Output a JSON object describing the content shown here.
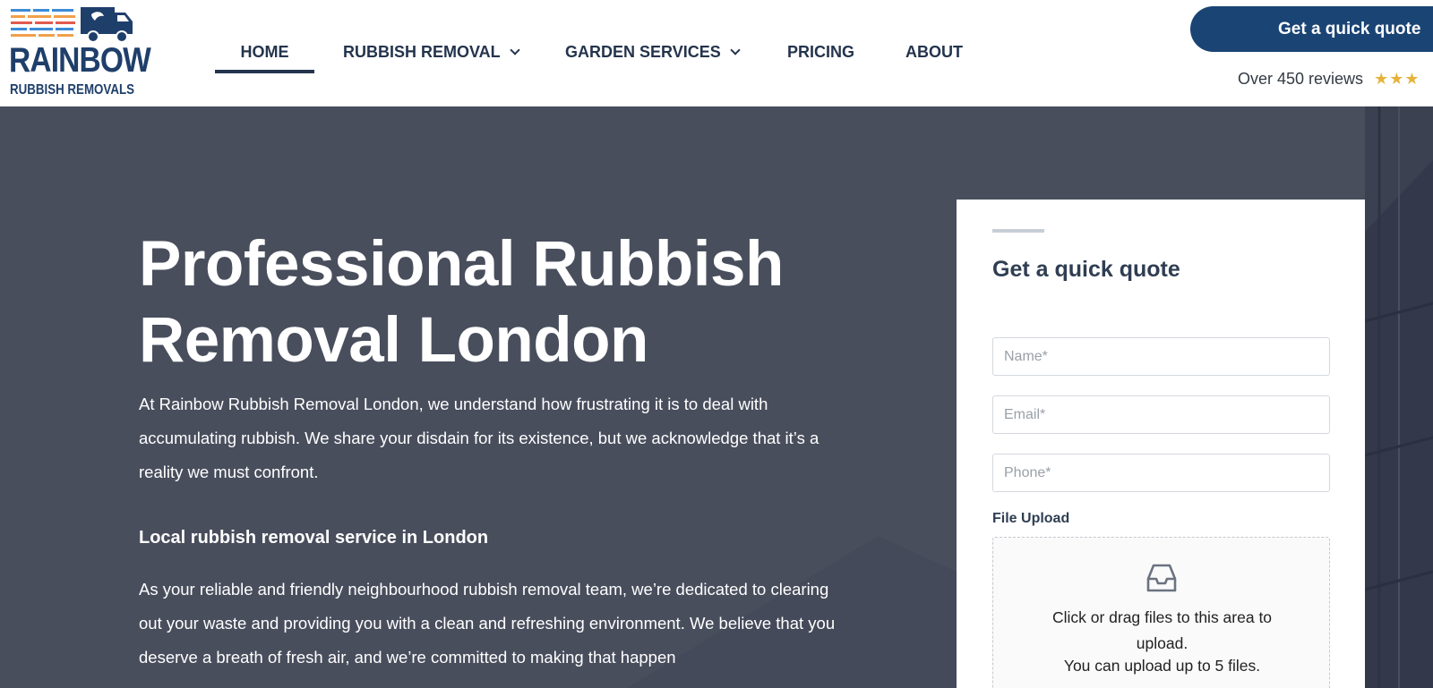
{
  "brand": {
    "name_line1": "RAINBOW",
    "name_line2": "RUBBISH REMOVALS",
    "colors": {
      "navy": "#1f3f6b",
      "stripe_blue": "#3b8bd8",
      "stripe_orange": "#f0a04b",
      "stripe_red": "#e25b4f"
    }
  },
  "nav": {
    "items": [
      {
        "label": "HOME",
        "active": true
      },
      {
        "label": "RUBBISH REMOVAL",
        "has_dropdown": true
      },
      {
        "label": "GARDEN SERVICES",
        "has_dropdown": true
      },
      {
        "label": "PRICING"
      },
      {
        "label": "ABOUT"
      }
    ]
  },
  "header_cta": {
    "button_label": "Get a quick quote",
    "reviews_text": "Over 450 reviews",
    "stars": "★★★"
  },
  "hero": {
    "title": "Professional Rubbish Removal London",
    "intro": "At Rainbow Rubbish Removal London, we understand how frustrating it is to deal with accumulating rubbish. We share your disdain for its existence, but we acknowledge that it’s a reality we must confront.",
    "subheading": "Local rubbish removal service in London",
    "body": "As your reliable and friendly neighbourhood rubbish removal team, we’re dedicated to clearing out your waste and providing you with a clean and refreshing environment. We believe that you deserve a breath of fresh air, and we’re committed to making that happen",
    "background_color": "#494e5d"
  },
  "quote_form": {
    "title": "Get a quick quote",
    "name_placeholder": "Name*",
    "email_placeholder": "Email*",
    "phone_placeholder": "Phone*",
    "upload_label": "File Upload",
    "upload_hint": "Click or drag files to this area to upload.",
    "upload_limit": "You can upload up to 5 files.",
    "upload_icon": "inbox-icon"
  }
}
